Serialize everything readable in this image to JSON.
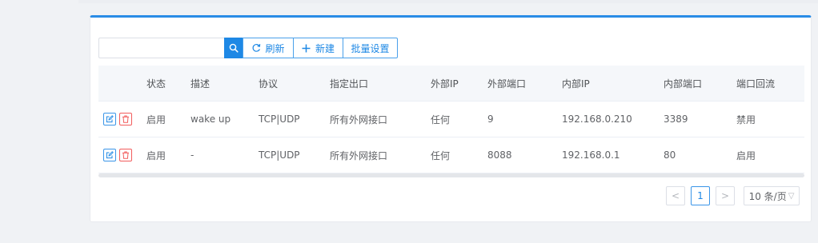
{
  "toolbar": {
    "search_value": "",
    "search_icon": "search-icon",
    "refresh_label": "刷新",
    "new_label": "新建",
    "batch_label": "批量设置"
  },
  "table": {
    "columns": [
      "状态",
      "描述",
      "协议",
      "指定出口",
      "外部IP",
      "外部端口",
      "内部IP",
      "内部端口",
      "端口回流"
    ],
    "rows": [
      {
        "state": "启用",
        "desc": "wake up",
        "proto": "TCP|UDP",
        "exit": "所有外网接口",
        "ext_ip": "任何",
        "ext_port": "9",
        "int_ip": "192.168.0.210",
        "int_port": "3389",
        "loop": "禁用"
      },
      {
        "state": "启用",
        "desc": "-",
        "proto": "TCP|UDP",
        "exit": "所有外网接口",
        "ext_ip": "任何",
        "ext_port": "8088",
        "int_ip": "192.168.0.1",
        "int_port": "80",
        "loop": "启用"
      }
    ]
  },
  "pagination": {
    "prev": "<",
    "current_page": "1",
    "next": ">",
    "page_size": "10 条/页"
  },
  "colors": {
    "accent": "#1e88e5",
    "danger": "#f25c5c"
  }
}
